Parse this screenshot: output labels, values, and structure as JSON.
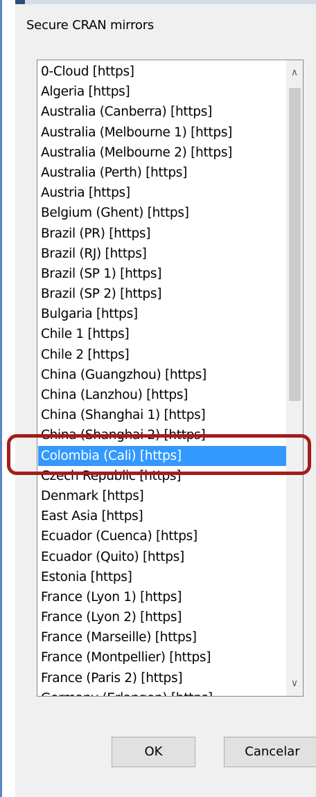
{
  "window": {
    "title": "Secure CRAN mirrors"
  },
  "mirrors": [
    "0-Cloud [https]",
    "Algeria [https]",
    "Australia (Canberra) [https]",
    "Australia (Melbourne 1) [https]",
    "Australia (Melbourne 2) [https]",
    "Australia (Perth) [https]",
    "Austria [https]",
    "Belgium (Ghent) [https]",
    "Brazil (PR) [https]",
    "Brazil (RJ) [https]",
    "Brazil (SP 1) [https]",
    "Brazil (SP 2) [https]",
    "Bulgaria [https]",
    "Chile 1 [https]",
    "Chile 2 [https]",
    "China (Guangzhou) [https]",
    "China (Lanzhou) [https]",
    "China (Shanghai 1) [https]",
    "China (Shanghai 2) [https]",
    "Colombia (Cali) [https]",
    "Czech Republic [https]",
    "Denmark [https]",
    "East Asia [https]",
    "Ecuador (Cuenca) [https]",
    "Ecuador (Quito) [https]",
    "Estonia [https]",
    "France (Lyon 1) [https]",
    "France (Lyon 2) [https]",
    "France (Marseille) [https]",
    "France (Montpellier) [https]",
    "France (Paris 2) [https]",
    "Germany (Erlangen) [https]"
  ],
  "selected_mirror": "Colombia (Cali) [https]",
  "buttons": {
    "ok": "OK",
    "cancel": "Cancelar"
  },
  "icons": {
    "scroll_up": "chevron-up-icon",
    "scroll_down": "chevron-down-icon"
  },
  "colors": {
    "selection": "#3399ff",
    "highlight_annotation": "#a51c1c"
  }
}
